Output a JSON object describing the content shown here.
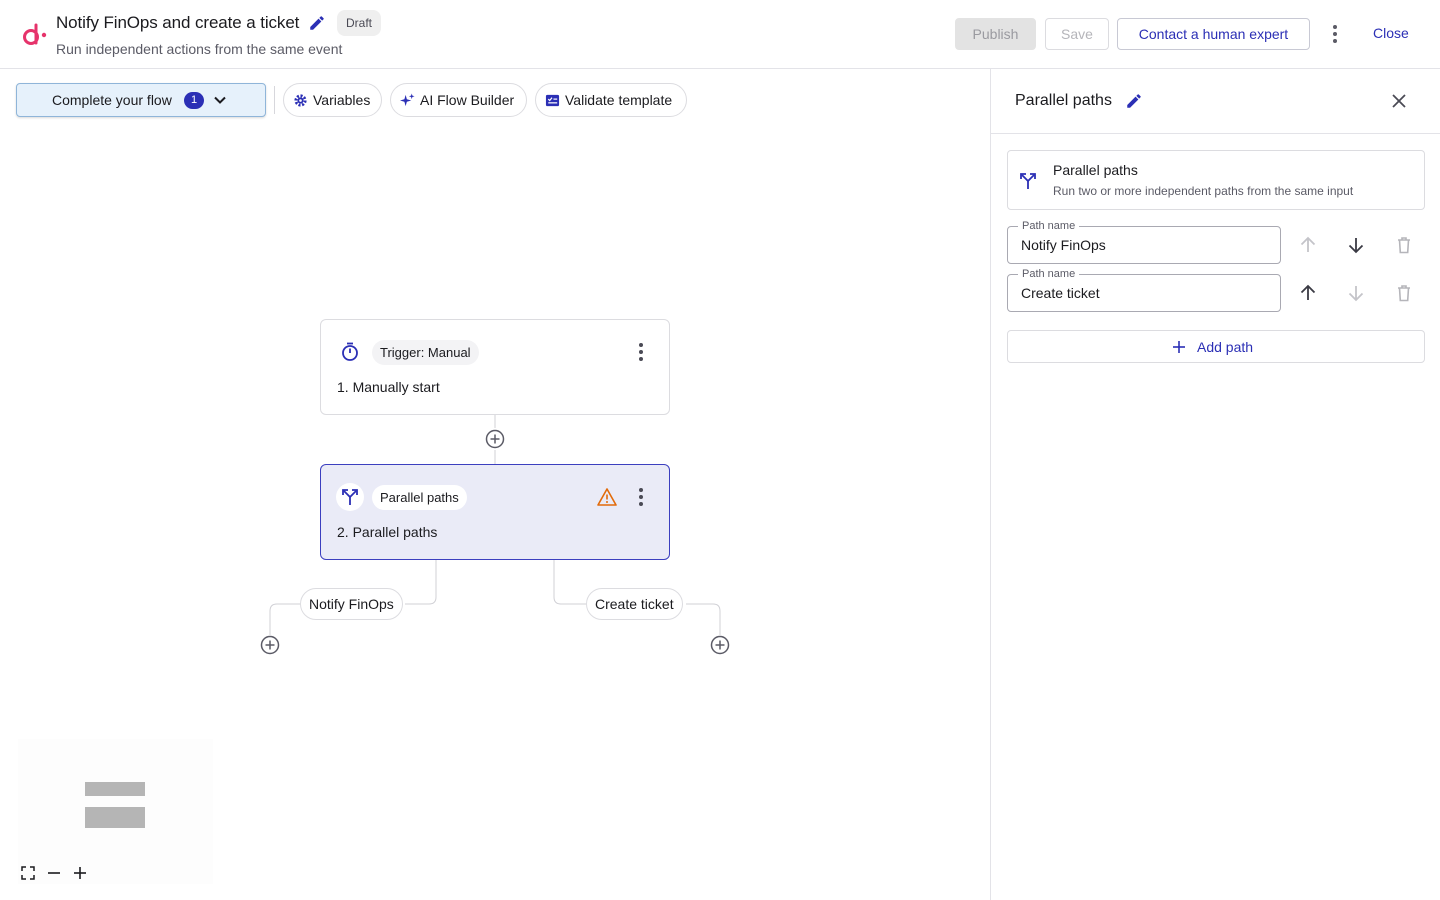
{
  "header": {
    "title": "Notify FinOps and create a ticket",
    "status_badge": "Draft",
    "subtitle": "Run independent actions from the same event",
    "publish_label": "Publish",
    "save_label": "Save",
    "expert_label": "Contact a human expert",
    "close_label": "Close"
  },
  "toolbar": {
    "complete_flow_label": "Complete your flow",
    "complete_flow_count": "1",
    "variables_label": "Variables",
    "ai_builder_label": "AI Flow Builder",
    "validate_label": "Validate template"
  },
  "flow": {
    "nodes": [
      {
        "tag": "Trigger: Manual",
        "title": "1. Manually start",
        "icon": "stopwatch-icon"
      },
      {
        "tag": "Parallel paths",
        "title": "2. Parallel paths",
        "icon": "split-arrows-icon",
        "warning": true
      }
    ],
    "branches": [
      "Notify FinOps",
      "Create ticket"
    ]
  },
  "panel": {
    "title": "Parallel paths",
    "card_title": "Parallel paths",
    "card_description": "Run two or more independent paths from the same input",
    "field_legend": "Path name",
    "paths": [
      {
        "name": "Notify FinOps",
        "can_move_up": false,
        "can_move_down": true
      },
      {
        "name": "Create ticket",
        "can_move_up": true,
        "can_move_down": false
      }
    ],
    "add_path_label": "Add path"
  },
  "colors": {
    "accent": "#2b2fb5",
    "brand": "#e6336b",
    "selected_node_bg": "#eaebf7",
    "warning": "#e26b0a"
  }
}
